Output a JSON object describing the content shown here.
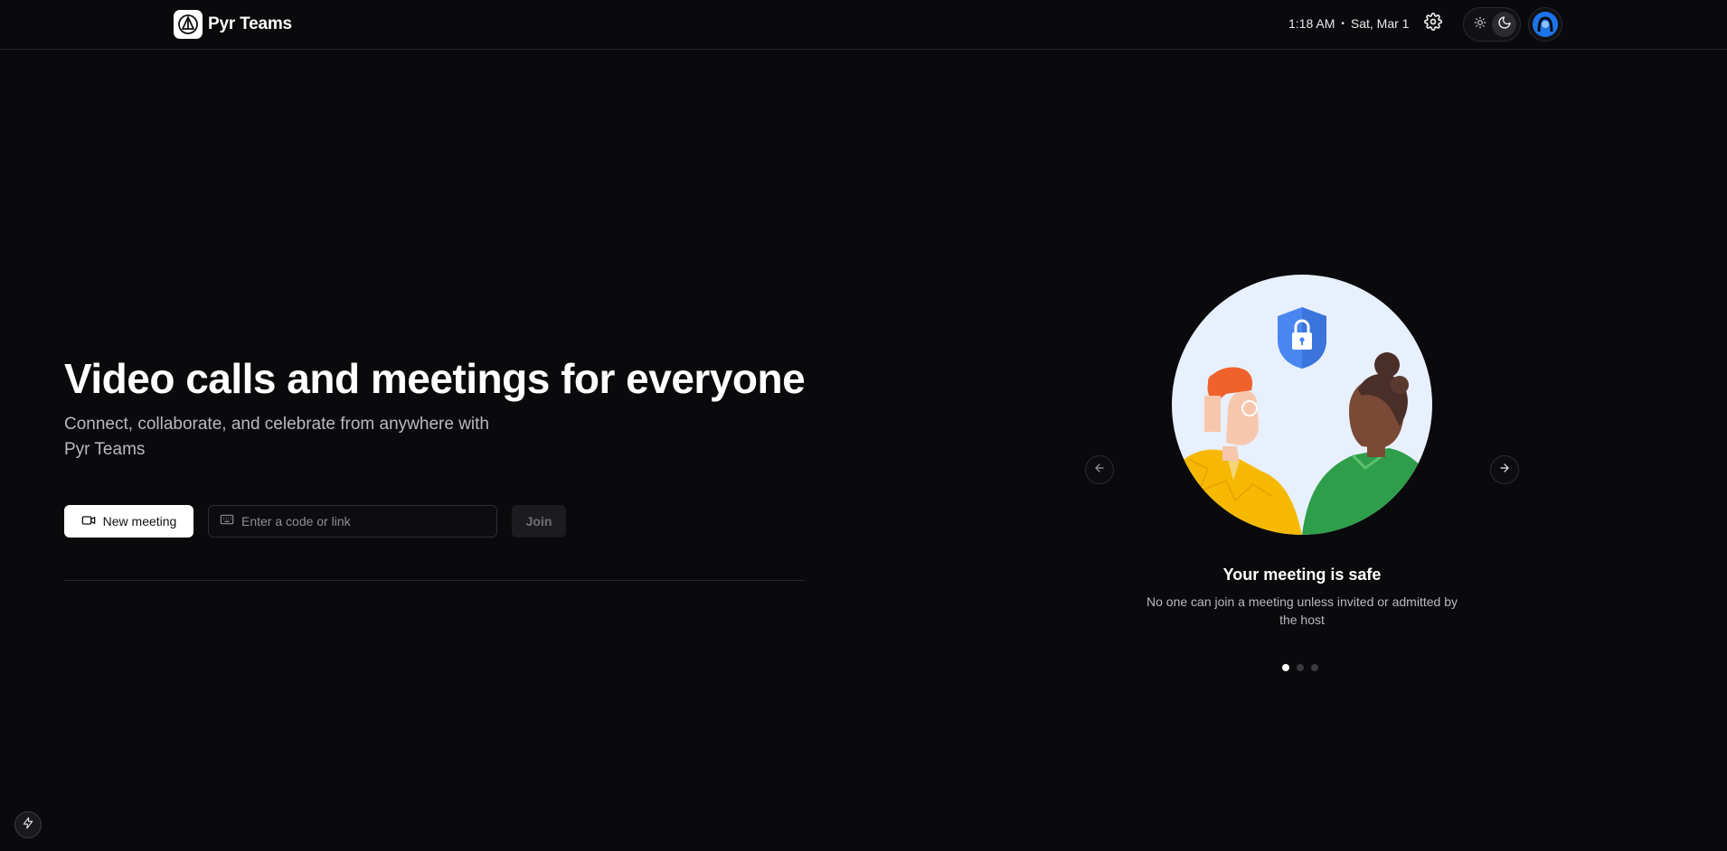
{
  "header": {
    "brand_name": "Pyr Teams",
    "time": "1:18 AM",
    "separator": "•",
    "date": "Sat, Mar 1",
    "theme_options": [
      "light",
      "dark"
    ],
    "active_theme": "dark"
  },
  "hero": {
    "title": "Video calls and meetings for everyone",
    "subtitle": "Connect, collaborate, and celebrate from anywhere with Pyr Teams",
    "new_meeting_label": "New meeting",
    "code_placeholder": "Enter a code or link",
    "code_value": "",
    "join_label": "Join"
  },
  "carousel": {
    "slide_title": "Your meeting is safe",
    "slide_description": "No one can join a meeting unless invited or admitted by the host",
    "slide_count": 3,
    "active_slide": 1
  },
  "icons": {
    "brand": "pyr-logo-icon",
    "settings": "gear-icon",
    "light": "sun-icon",
    "dark": "moon-icon",
    "avatar": "user-avatar-icon",
    "new_meeting": "video-camera-icon",
    "code": "keyboard-icon",
    "prev": "arrow-left-icon",
    "next": "arrow-right-icon",
    "bolt": "lightning-bolt-icon"
  },
  "colors": {
    "background": "#0a0a0c",
    "shield": "#4a86f0",
    "avatar": "#1e73e8",
    "illustration_bg": "#e8f0fe"
  }
}
